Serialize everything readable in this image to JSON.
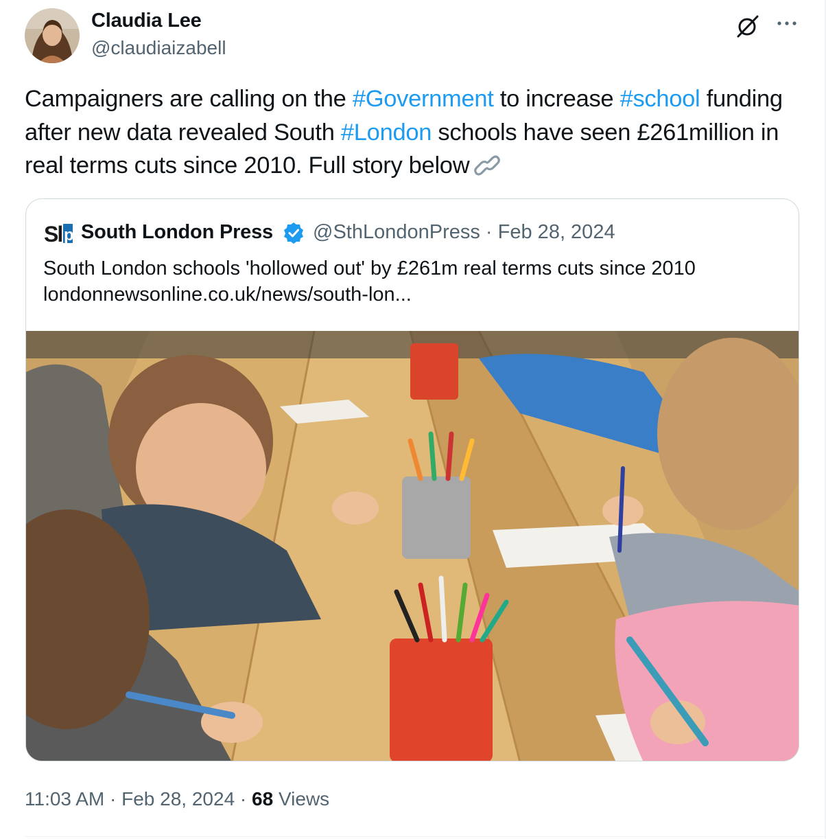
{
  "author": {
    "name": "Claudia Lee",
    "handle": "@claudiaizabell",
    "avatar_icon": "profile-photo"
  },
  "tweet": {
    "segments": [
      {
        "text": "Campaigners are calling on the ",
        "type": "text"
      },
      {
        "text": "#Government",
        "type": "hashtag"
      },
      {
        "text": " to increase ",
        "type": "text"
      },
      {
        "text": "#school",
        "type": "hashtag"
      },
      {
        "text": " funding after new data revealed South ",
        "type": "text"
      },
      {
        "text": "#London",
        "type": "hashtag"
      },
      {
        "text": " schools have seen £261million in real terms cuts since 2010. Full story below",
        "type": "text"
      }
    ],
    "emoji_icon": "link-emoji"
  },
  "quote": {
    "logo_icon": "slp-logo",
    "name": "South London Press",
    "verified_icon": "verified-badge",
    "handle": "@SthLondonPress",
    "separator": " · ",
    "date": "Feb 28, 2024",
    "text": "South London schools 'hollowed out' by £261m real terms cuts since 2010",
    "link": "londonnewsonline.co.uk/news/south-lon...",
    "image_icon": "children-drawing-photo"
  },
  "footer": {
    "time": "11:03 AM",
    "sep1": " · ",
    "date": "Feb 28, 2024",
    "sep2": " · ",
    "views_count": "68",
    "views_label": " Views"
  },
  "colors": {
    "accent": "#1d9bf0",
    "text": "#0f1419",
    "secondary": "#536471",
    "border": "#cfd9de"
  }
}
